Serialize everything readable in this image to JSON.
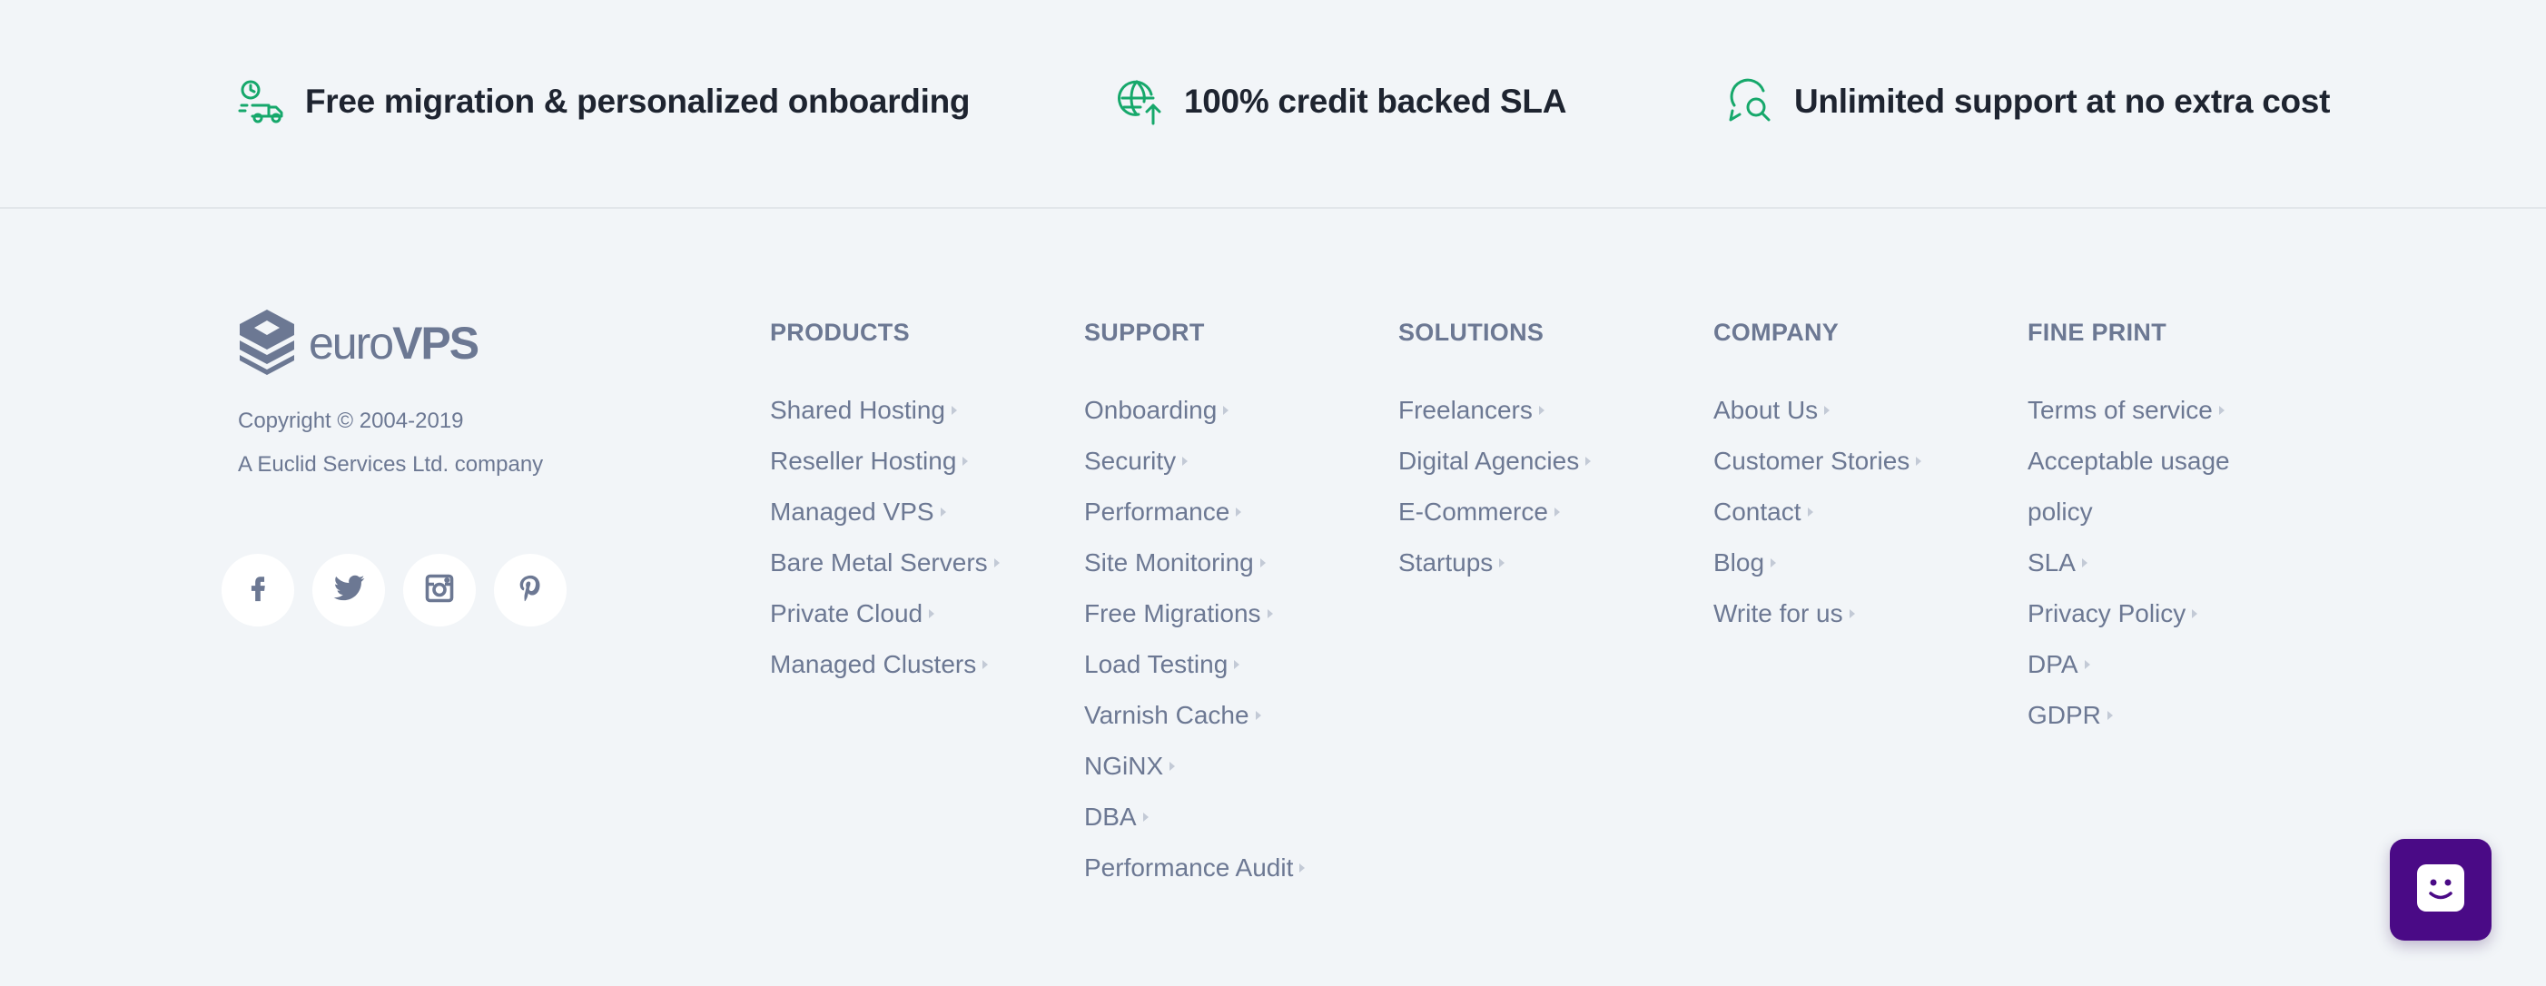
{
  "features": [
    {
      "icon": "truck-clock-icon",
      "text": "Free migration & personalized onboarding"
    },
    {
      "icon": "globe-upload-icon",
      "text": "100% credit backed SLA"
    },
    {
      "icon": "support-search-icon",
      "text": "Unlimited support at no extra cost"
    }
  ],
  "brand": {
    "logo_light": "euro",
    "logo_bold": "VPS",
    "copyright": "Copyright © 2004-2019",
    "company": "A Euclid Services Ltd. company"
  },
  "socials": [
    "facebook-icon",
    "twitter-icon",
    "instagram-icon",
    "pinterest-icon"
  ],
  "columns": [
    {
      "title": "PRODUCTS",
      "links": [
        "Shared Hosting",
        "Reseller Hosting",
        "Managed VPS",
        "Bare Metal Servers",
        "Private Cloud",
        "Managed Clusters"
      ]
    },
    {
      "title": "SUPPORT",
      "links": [
        "Onboarding",
        "Security",
        "Performance",
        "Site Monitoring",
        "Free Migrations",
        "Load Testing",
        "Varnish Cache",
        "NGiNX",
        "DBA",
        "Performance Audit"
      ]
    },
    {
      "title": "SOLUTIONS",
      "links": [
        "Freelancers",
        "Digital Agencies",
        "E-Commerce",
        "Startups"
      ]
    },
    {
      "title": "COMPANY",
      "links": [
        "About Us",
        "Customer Stories",
        "Contact",
        "Blog",
        "Write for us"
      ]
    },
    {
      "title": "FINE PRINT",
      "links": [
        "Terms of service",
        "Acceptable usage",
        "policy",
        "SLA",
        "Privacy Policy",
        "DPA",
        "GDPR"
      ]
    }
  ],
  "colors": {
    "accent": "#16a86b",
    "text_muted": "#6c7893",
    "chat": "#4a0a86"
  }
}
